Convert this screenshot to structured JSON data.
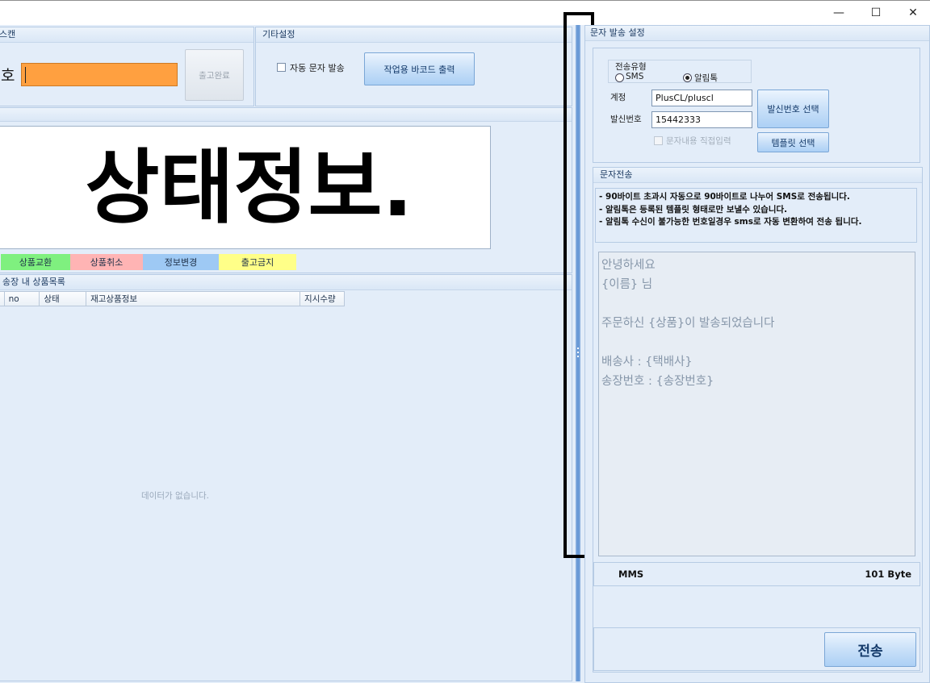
{
  "window": {
    "minimize_glyph": "—",
    "maximize_glyph": "☐",
    "close_glyph": "✕"
  },
  "scan_panel": {
    "title": "스캔",
    "field_label": "호",
    "field_value": "",
    "complete_button": "출고완료",
    "accent_color": "#ffa040"
  },
  "other_settings": {
    "title": "기타설정",
    "auto_sms_label": "자동 문자 발송",
    "barcode_button": "작업용 바코드 출력"
  },
  "status_display": {
    "text": "상태정보."
  },
  "status_buttons": [
    {
      "label": "상품교환",
      "color": "#7ff07f"
    },
    {
      "label": "상품취소",
      "color": "#ffb4b4"
    },
    {
      "label": "정보변경",
      "color": "#9ec9f4"
    },
    {
      "label": "출고금지",
      "color": "#ffff88"
    }
  ],
  "product_list": {
    "title": "송장 내 상품목록",
    "columns": [
      "no",
      "상태",
      "재고상품정보",
      "지시수량"
    ],
    "empty_message": "데이터가 없습니다."
  },
  "sms_settings": {
    "title": "문자 발송 설정",
    "send_type_label": "전송유형",
    "send_types": [
      "SMS",
      "알림톡"
    ],
    "selected_type": "알림톡",
    "account_label": "계정",
    "account_value": "PlusCL/pluscl",
    "sender_label": "발신번호",
    "sender_value": "15442333",
    "sender_button": "발신번호 선택",
    "direct_input_label": "문자내용 직접입력",
    "template_button": "템플릿 선택"
  },
  "sms_send": {
    "title": "문자전송",
    "notes": [
      "- 90바이트 초과시 자동으로 90바이트로 나누어 SMS로 전송됩니다.",
      "- 알림톡은 등록된 템플릿 형태로만 보낼수 있습니다.",
      "- 알림톡 수신이 불가능한 번호일경우 sms로 자동 변환하여 전송 됩니다."
    ],
    "message_lines": [
      "안녕하세요",
      "{이름} 님",
      "",
      "주문하신 {상품}이 발송되었습니다",
      "",
      "배송사 : {택배사}",
      "송장번호 : {송장번호}"
    ],
    "message_type": "MMS",
    "byte_count": "101 Byte",
    "send_button": "전송"
  }
}
